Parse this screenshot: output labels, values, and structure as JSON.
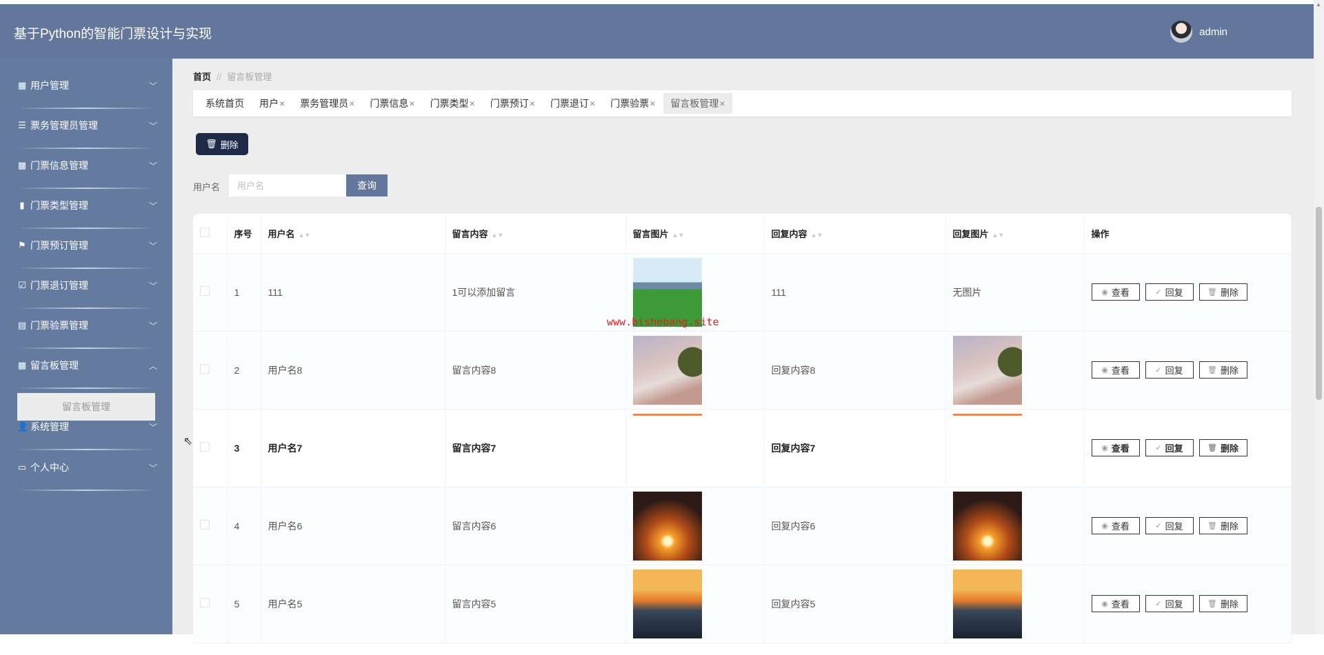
{
  "header": {
    "title": "基于Python的智能门票设计与实现",
    "username": "admin"
  },
  "sidebar": {
    "items": [
      {
        "label": "用户管理",
        "icon": "grid-icon"
      },
      {
        "label": "票务管理员管理",
        "icon": "list-icon"
      },
      {
        "label": "门票信息管理",
        "icon": "grid-icon"
      },
      {
        "label": "门票类型管理",
        "icon": "bar-chart-icon"
      },
      {
        "label": "门票预订管理",
        "icon": "flag-icon"
      },
      {
        "label": "门票退订管理",
        "icon": "clipboard-check-icon"
      },
      {
        "label": "门票验票管理",
        "icon": "clipboard-icon"
      },
      {
        "label": "留言板管理",
        "icon": "grid-icon",
        "expanded": true
      },
      {
        "label": "系统管理",
        "icon": "user-icon"
      },
      {
        "label": "个人中心",
        "icon": "card-icon"
      }
    ],
    "submenu": "留言板管理"
  },
  "breadcrumb": {
    "home": "首页",
    "separator": "//",
    "current": "留言板管理"
  },
  "tabs": [
    {
      "label": "系统首页"
    },
    {
      "label": "用户",
      "close": "×"
    },
    {
      "label": "票务管理员",
      "close": "×"
    },
    {
      "label": "门票信息",
      "close": "×"
    },
    {
      "label": "门票类型",
      "close": "×"
    },
    {
      "label": "门票预订",
      "close": "×"
    },
    {
      "label": "门票退订",
      "close": "×"
    },
    {
      "label": "门票验票",
      "close": "×"
    },
    {
      "label": "留言板管理",
      "close": "×",
      "active": true
    }
  ],
  "toolbar": {
    "delete_label": "删除"
  },
  "search": {
    "label": "用户名",
    "placeholder": "用户名",
    "value": "",
    "button": "查询"
  },
  "table": {
    "headers": [
      "序号",
      "用户名",
      "留言内容",
      "留言图片",
      "回复内容",
      "回复图片",
      "操作"
    ],
    "actions": {
      "view": "查看",
      "reply": "回复",
      "delete": "删除"
    },
    "rows": [
      {
        "index": "1",
        "username": "111",
        "content": "1可以添加留言",
        "image": "field",
        "reply": "111",
        "reply_image": "无图片"
      },
      {
        "index": "2",
        "username": "用户名8",
        "content": "留言内容8",
        "image": "mist",
        "reply": "回复内容8",
        "reply_image": "mist"
      },
      {
        "index": "3",
        "username": "用户名7",
        "content": "留言内容7",
        "image": "strip",
        "reply": "回复内容7",
        "reply_image": "strip"
      },
      {
        "index": "4",
        "username": "用户名6",
        "content": "留言内容6",
        "image": "palm",
        "reply": "回复内容6",
        "reply_image": "palm"
      },
      {
        "index": "5",
        "username": "用户名5",
        "content": "留言内容5",
        "image": "sea",
        "reply": "回复内容5",
        "reply_image": "sea"
      }
    ]
  },
  "watermark": "www.bishebang.site",
  "colors": {
    "header": "#62779b",
    "sidebar": "#657a9f",
    "primary_dark": "#1e2a47",
    "watermark": "#e02020"
  }
}
